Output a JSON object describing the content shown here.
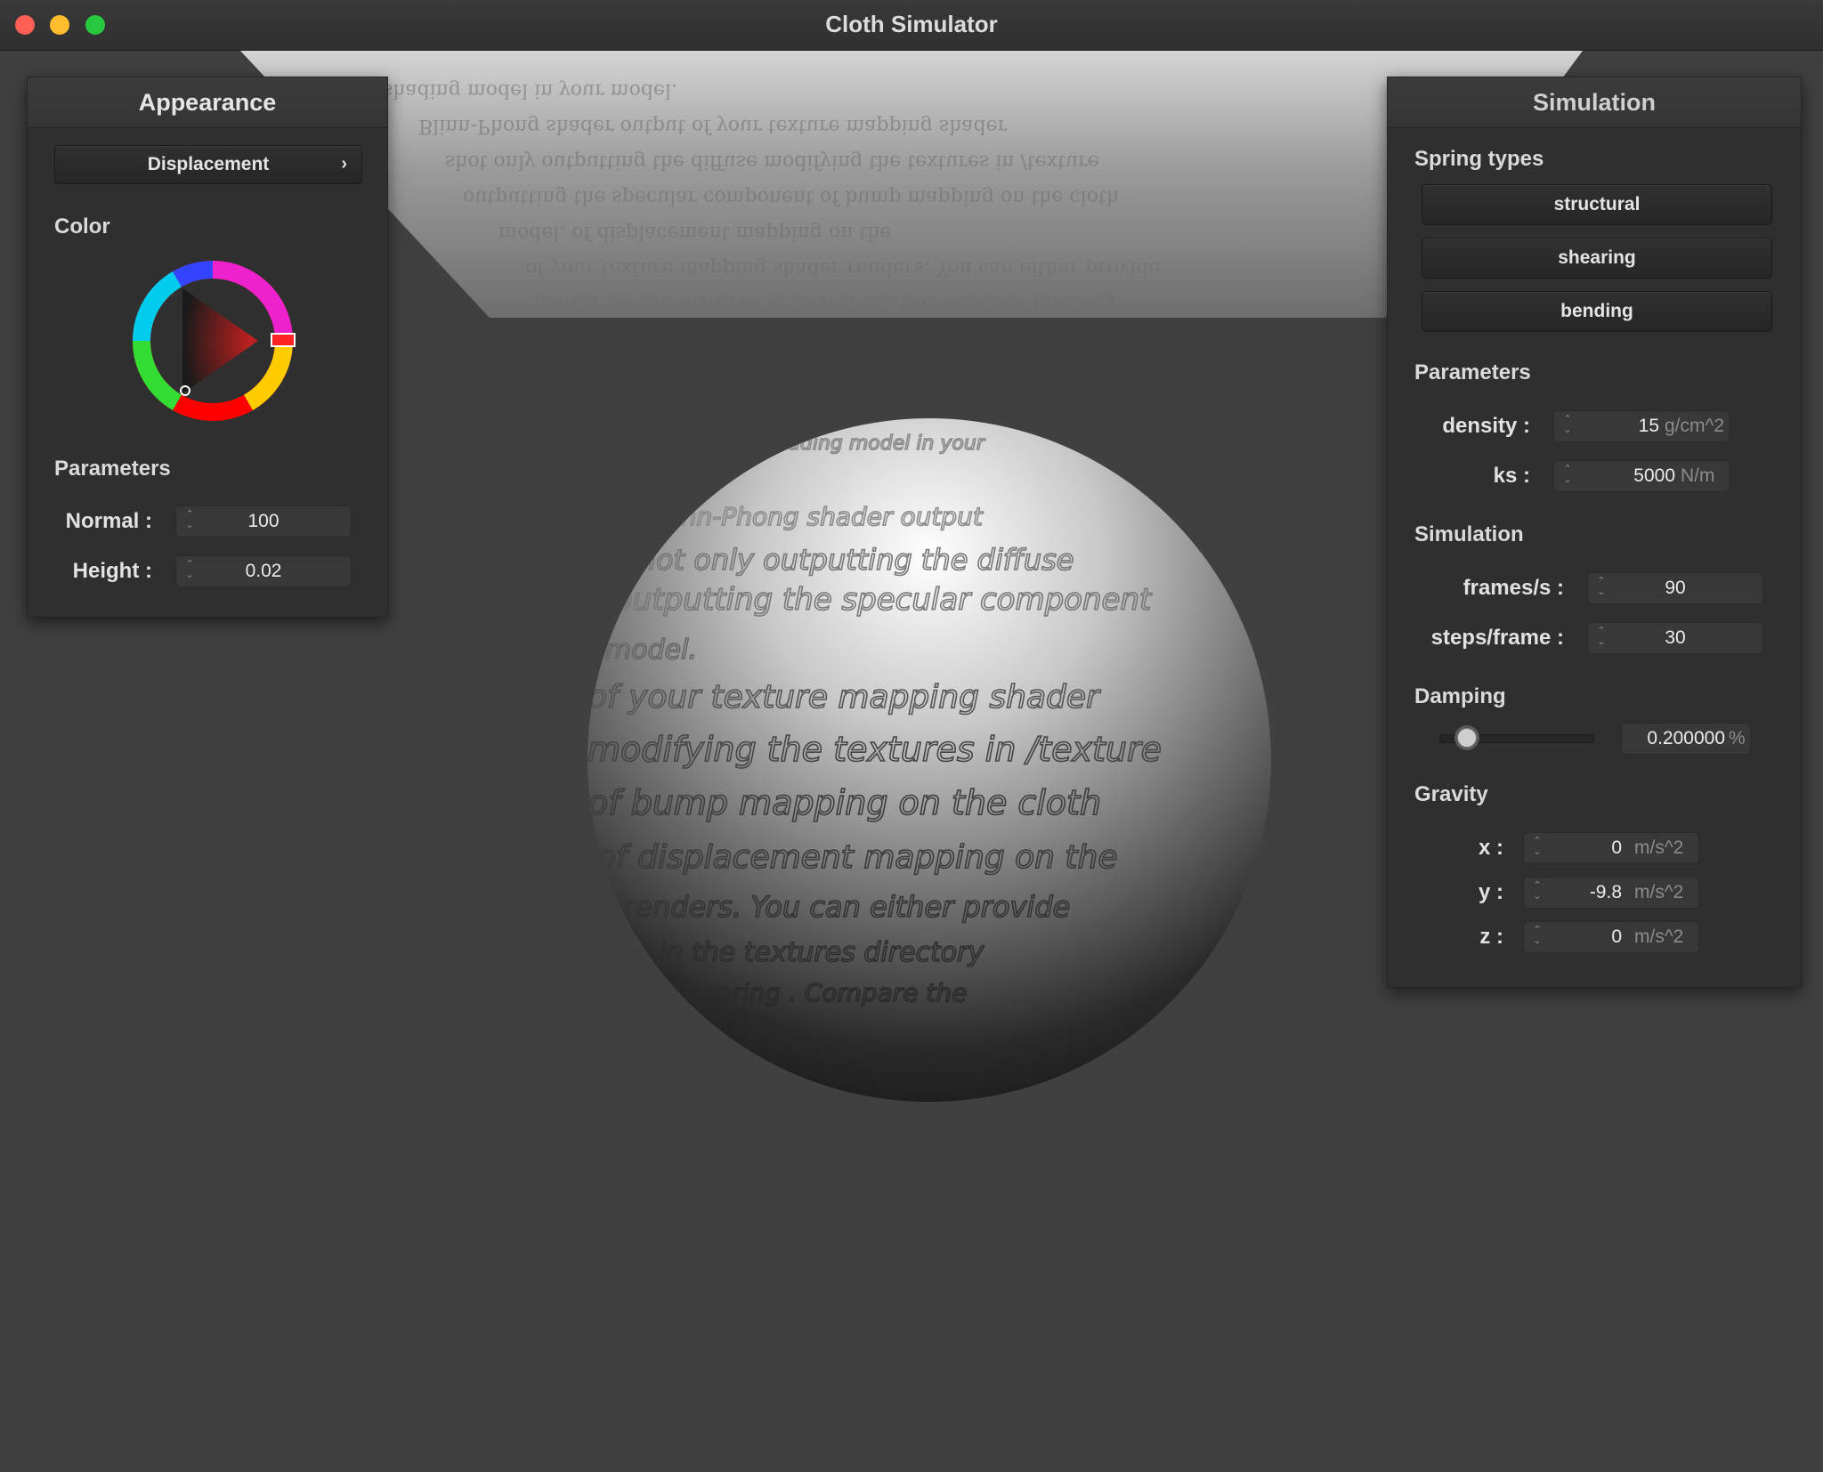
{
  "window": {
    "title": "Cloth Simulator"
  },
  "viewport": {
    "cloth_text": [
      "shading model in your",
      "Blinn-Phong shader output",
      "shot only outputting the diffuse",
      "outputting the specular component",
      "model.",
      "of your texture mapping shader",
      "modifying the textures in /texture",
      "of bump mapping on the cloth",
      "of displacement mapping on the",
      "renders. You can either provide",
      "in the textures directory",
      "spring . Compare the"
    ]
  },
  "appearance": {
    "title": "Appearance",
    "shader_select": "Displacement",
    "color_label": "Color",
    "color_value": "#c02020",
    "params_label": "Parameters",
    "normal_label": "Normal :",
    "normal_value": "100",
    "height_label": "Height :",
    "height_value": "0.02"
  },
  "simulation": {
    "title": "Simulation",
    "spring_types_label": "Spring types",
    "spring_buttons": [
      "structural",
      "shearing",
      "bending"
    ],
    "params_label": "Parameters",
    "density_label": "density :",
    "density_value": "15",
    "density_unit": "g/cm^2",
    "ks_label": "ks :",
    "ks_value": "5000",
    "ks_unit": "N/m",
    "sim_label": "Simulation",
    "fps_label": "frames/s :",
    "fps_value": "90",
    "steps_label": "steps/frame :",
    "steps_value": "30",
    "damping_label": "Damping",
    "damping_value": "0.200000",
    "damping_unit": "%",
    "gravity_label": "Gravity",
    "gx_label": "x :",
    "gx_value": "0",
    "gy_label": "y :",
    "gy_value": "-9.8",
    "gz_label": "z :",
    "gz_value": "0",
    "gravity_unit": "m/s^2"
  }
}
